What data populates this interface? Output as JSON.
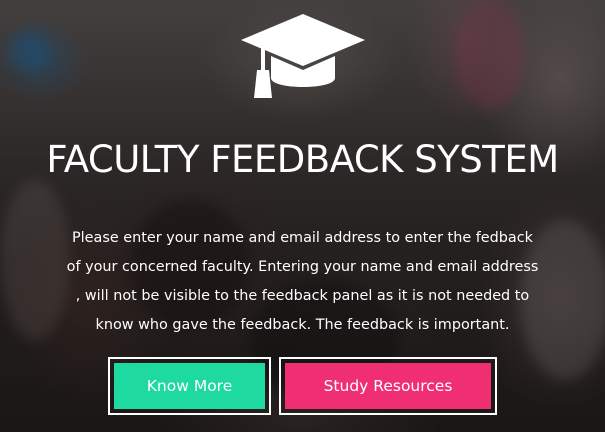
{
  "hero": {
    "icon": "graduation-cap-icon",
    "title": "FACULTY FEEDBACK SYSTEM",
    "description_lines": [
      "Please enter your name and email address to enter the fedback",
      "of your concerned faculty. Entering your name and email address",
      ", will not be visible to the feedback panel as it is not needed to",
      "know who gave the feedback. The feedback is important."
    ]
  },
  "buttons": {
    "know_more": "Know More",
    "study_resources": "Study Resources"
  },
  "colors": {
    "know_more_bg": "#1ed9a0",
    "study_resources_bg": "#ef2f72",
    "text": "#ffffff"
  }
}
